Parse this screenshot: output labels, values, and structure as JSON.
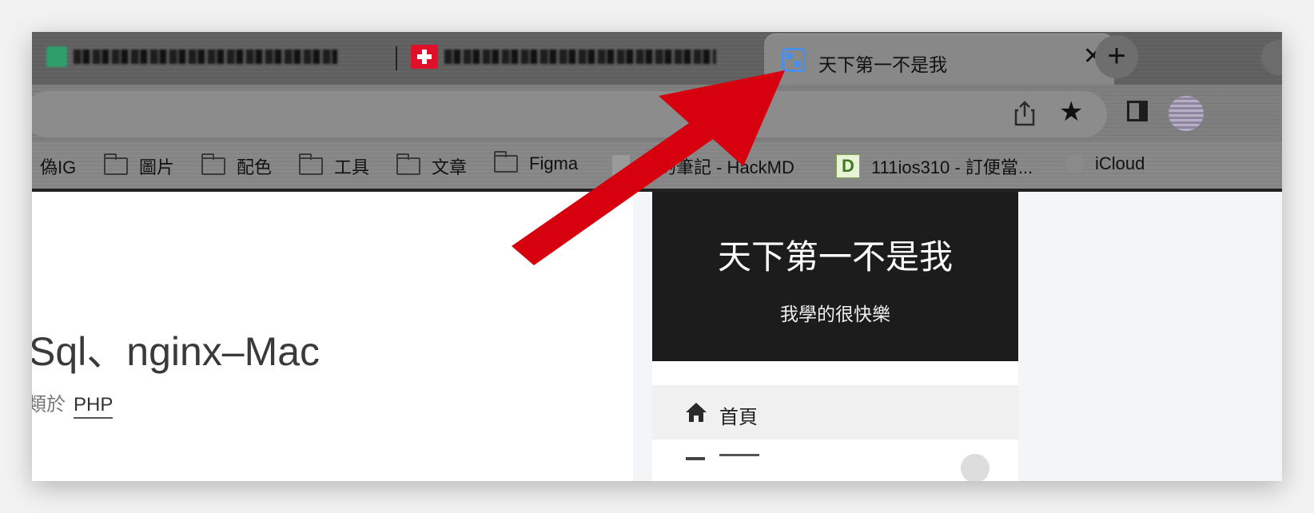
{
  "tabs": {
    "active_title": "天下第一不是我",
    "close_glyph": "✕",
    "new_tab_glyph": "+"
  },
  "toolbar": {
    "star_glyph": "★"
  },
  "bookmarks": [
    {
      "label": "偽IG",
      "icon": "none"
    },
    {
      "label": "圖片",
      "icon": "folder-icon"
    },
    {
      "label": "配色",
      "icon": "folder-icon"
    },
    {
      "label": "工具",
      "icon": "folder-icon"
    },
    {
      "label": "文章",
      "icon": "folder-icon"
    },
    {
      "label": "Figma",
      "icon": "folder-icon"
    },
    {
      "label": "我的筆記 - HackMD",
      "icon": "page-icon"
    },
    {
      "label": "111ios310 - 訂便當...",
      "icon": "d-favicon"
    },
    {
      "label": "iCloud",
      "icon": "apple-icon"
    }
  ],
  "d_favicon_letter": "D",
  "post": {
    "title": "Sql、nginx–Mac",
    "meta_prefix": "類於",
    "category": "PHP"
  },
  "site": {
    "title": "天下第一不是我",
    "description": "我學的很快樂",
    "nav_home": "首頁"
  },
  "colors": {
    "arrow": "#d6000f",
    "header_bg": "#1c1c1c",
    "tab_icon": "#4b8ee8"
  }
}
